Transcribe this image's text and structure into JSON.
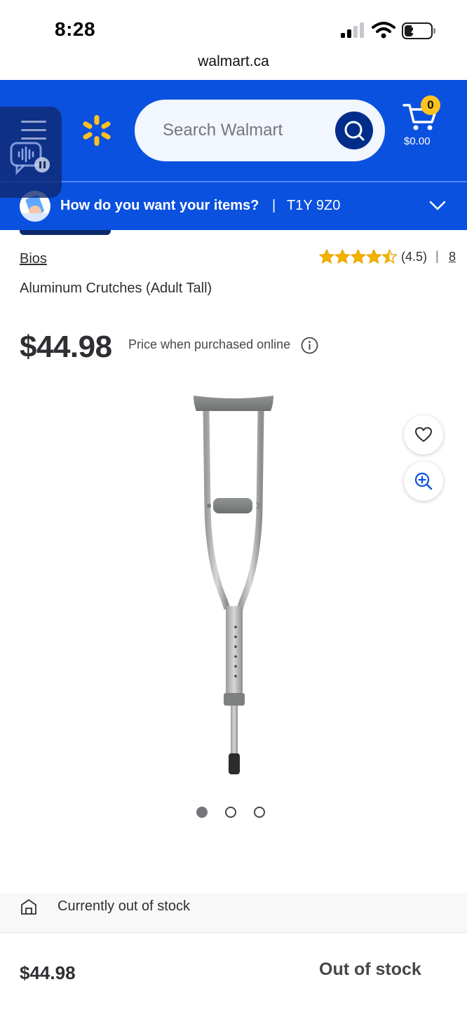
{
  "status_bar": {
    "time": "8:28",
    "battery": "21",
    "battery_level": 0.21
  },
  "browser": {
    "url": "walmart.ca"
  },
  "header": {
    "search_placeholder": "Search Walmart",
    "cart_count": "0",
    "cart_total": "$0.00",
    "brand_color": "#0b51df",
    "accent_color": "#ffc220"
  },
  "delivery": {
    "question": "How do you want your items?",
    "separator": "|",
    "postal_code": "T1Y 9Z0"
  },
  "product": {
    "brand": "Bios",
    "rating": 4.5,
    "rating_text": "(4.5)",
    "rating_separator": "|",
    "review_count": "8",
    "title": "Aluminum Crutches (Adult Tall)",
    "price": "$44.98",
    "price_note": "Price when purchased online",
    "image_count": 3,
    "active_image_index": 0
  },
  "icons": {
    "favorite": "heart-icon",
    "zoom": "zoom-in-icon",
    "info": "info-icon",
    "store": "store-icon",
    "cart": "cart-icon",
    "search": "search-icon",
    "menu": "hamburger-menu-icon"
  },
  "availability": {
    "status_message": "Currently out of stock"
  },
  "footer": {
    "price": "$44.98",
    "status": "Out of stock"
  }
}
